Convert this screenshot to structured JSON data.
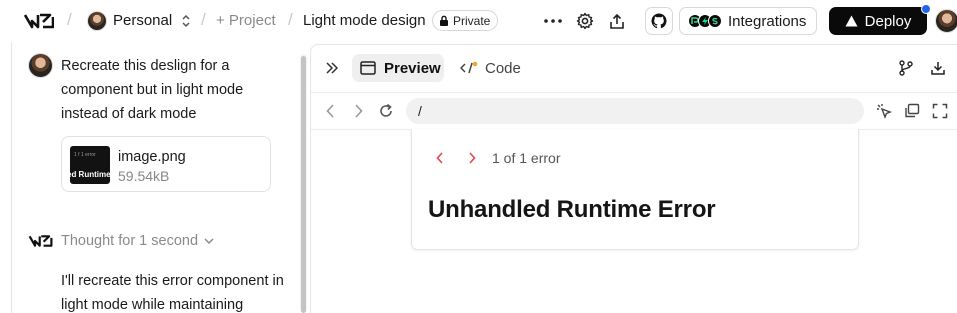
{
  "topbar": {
    "workspace": "Personal",
    "new_project": "+ Project",
    "project_title": "Light mode design",
    "private_badge": "Private",
    "integrations_label": "Integrations",
    "deploy_label": "Deploy"
  },
  "chat": {
    "user_message": "Recreate this deslign for a component but in light mode instead of dark mode",
    "attachment": {
      "name": "image.png",
      "size": "59.54kB",
      "thumb_title": "1 f 1 error",
      "thumb_caption": "ed Runtime"
    },
    "thought_label": "Thought for 1 second",
    "assistant_reply": "I'll recreate this error component in light mode while maintaining"
  },
  "preview": {
    "tab_preview": "Preview",
    "tab_code": "Code",
    "url": "/",
    "error": {
      "counter": "1 of 1 error",
      "title": "Unhandled Runtime Error"
    }
  },
  "colors": {
    "accent_blue": "#2563eb",
    "error_red": "#e5484d",
    "deploy_bg": "#0a0a0a"
  }
}
